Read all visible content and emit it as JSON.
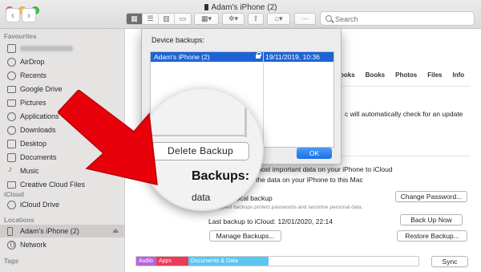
{
  "window": {
    "title": "Adam's iPhone (2)"
  },
  "toolbar": {
    "back_glyph": "‹",
    "forward_glyph": "›",
    "search_placeholder": "Search"
  },
  "sidebar": {
    "favourites_label": "Favourites",
    "favourites": [
      {
        "label": "",
        "icon": "user-home-icon",
        "redacted": true
      },
      {
        "label": "AirDrop",
        "icon": "airdrop-icon"
      },
      {
        "label": "Recents",
        "icon": "clock-icon"
      },
      {
        "label": "Google Drive",
        "icon": "drive-icon"
      },
      {
        "label": "Pictures",
        "icon": "folder-icon"
      },
      {
        "label": "Applications",
        "icon": "applications-icon"
      },
      {
        "label": "Downloads",
        "icon": "download-icon"
      },
      {
        "label": "Desktop",
        "icon": "desktop-icon"
      },
      {
        "label": "Documents",
        "icon": "document-icon"
      },
      {
        "label": "Music",
        "icon": "music-icon"
      },
      {
        "label": "Creative Cloud Files",
        "icon": "folder-icon"
      }
    ],
    "icloud_label": "iCloud",
    "icloud": [
      {
        "label": "iCloud Drive",
        "icon": "cloud-icon"
      }
    ],
    "locations_label": "Locations",
    "locations": [
      {
        "label": "Adam's iPhone (2)",
        "icon": "phone-icon",
        "selected": true
      },
      {
        "label": "Network",
        "icon": "globe-icon"
      }
    ],
    "tags_label": "Tags"
  },
  "main": {
    "tabs": [
      "ooks",
      "Books",
      "Photos",
      "Files",
      "Info"
    ],
    "update_text": "c will automatically check for an update",
    "icloud_option": "most important data on your iPhone to iCloud",
    "mac_option": "the data on your iPhone to this Mac",
    "encrypt_label": "pt local backup",
    "encrypt_note": "Encrypted backups protect passwords and sensitive personal data.",
    "change_password": "Change Password...",
    "last_backup": "Last backup to iCloud: 12/01/2020, 22:14",
    "back_up_now": "Back Up Now",
    "manage_backups": "Manage Backups...",
    "restore_backup": "Restore Backup...",
    "storage": {
      "audio": "Audio",
      "apps": "Apps",
      "docs": "Documents & Data"
    },
    "sync": "Sync"
  },
  "dialog": {
    "title": "Device backups:",
    "backup": {
      "name": "Adam's iPhone (2)",
      "date": "19/11/2019, 10:36",
      "locked": true
    },
    "ok": "OK"
  },
  "magnifier": {
    "delete_backup": "Delete Backup",
    "backups_heading": "Backups:",
    "fragment": "data"
  },
  "colors": {
    "selection_blue": "#1d63d4",
    "arrow_red": "#e8000b",
    "storage_audio": "#b866d9",
    "storage_apps": "#ea3a55",
    "storage_docs": "#5cc6f2"
  }
}
